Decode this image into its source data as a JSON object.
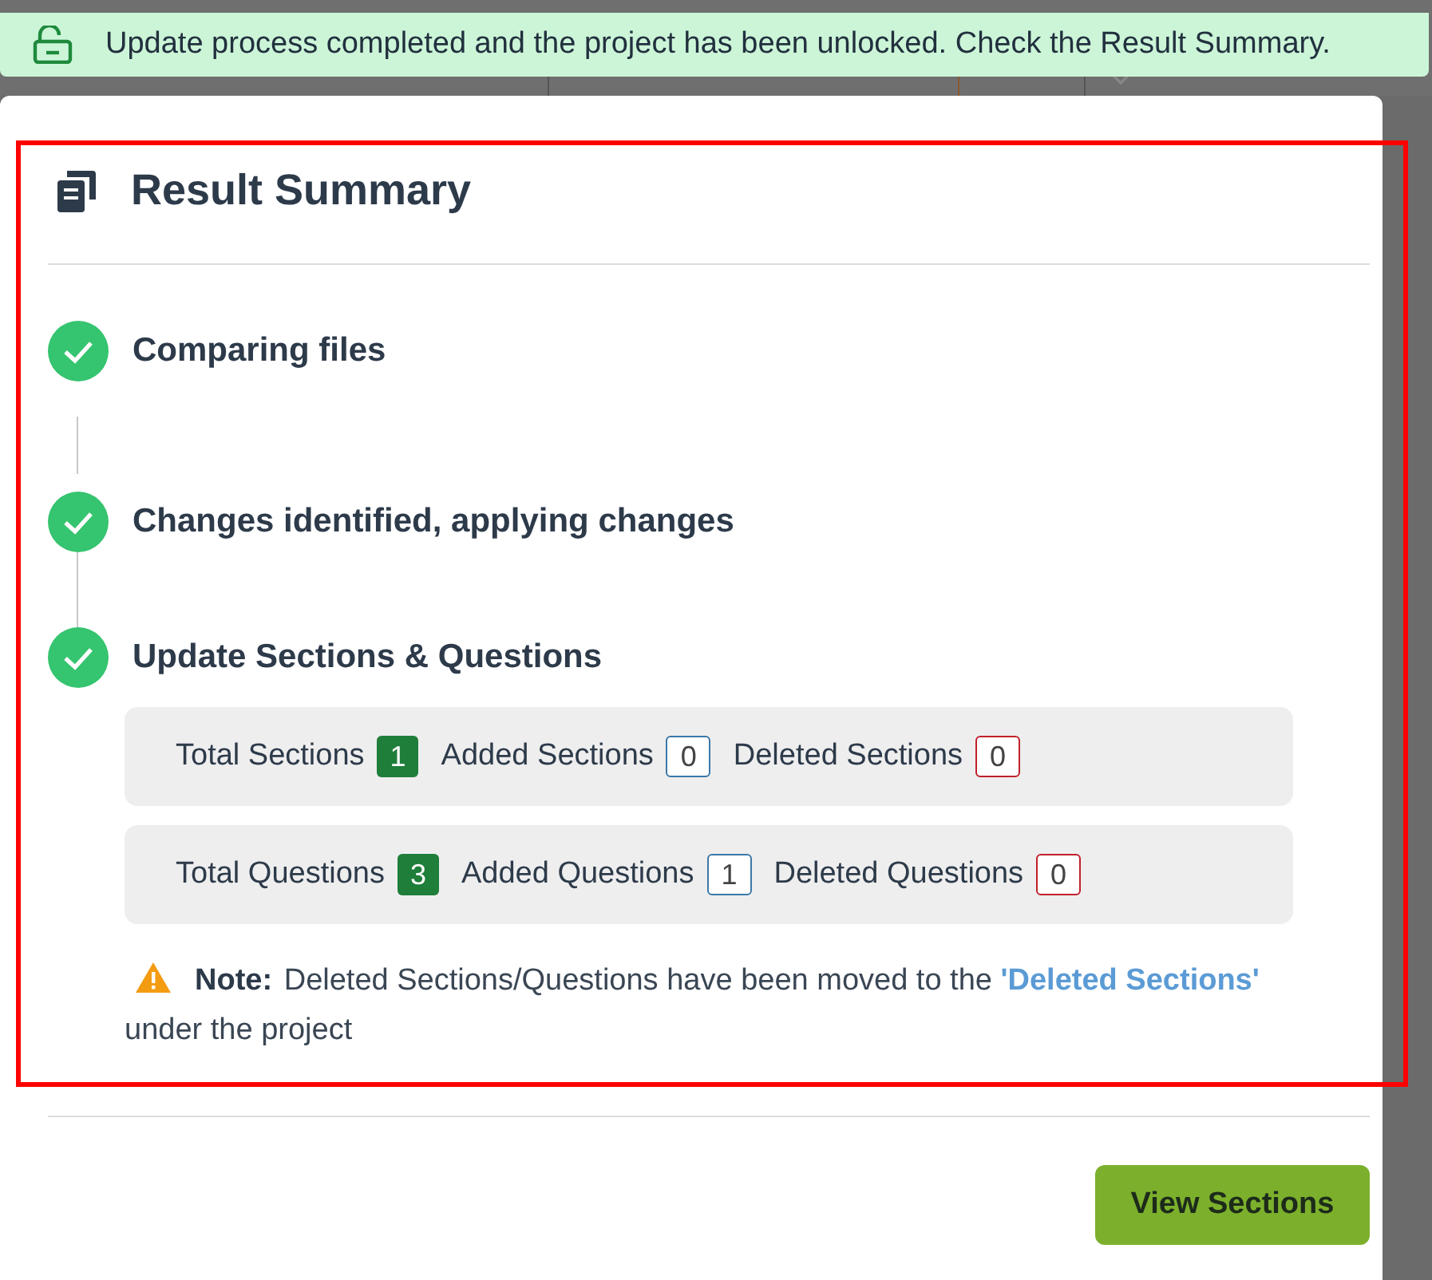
{
  "toast": {
    "message": "Update process completed and the project has been unlocked. Check the Result Summary."
  },
  "highlight": {
    "visible": true
  },
  "modal": {
    "title": "Result Summary",
    "steps": [
      {
        "label": "Comparing files",
        "done": true
      },
      {
        "label": "Changes identified, applying changes",
        "done": true
      },
      {
        "label": "Update Sections & Questions",
        "done": true
      }
    ],
    "stats": [
      [
        {
          "label": "Total Sections",
          "value": "1",
          "kind": "total"
        },
        {
          "label": "Added Sections",
          "value": "0",
          "kind": "added"
        },
        {
          "label": "Deleted Sections",
          "value": "0",
          "kind": "deleted"
        }
      ],
      [
        {
          "label": "Total Questions",
          "value": "3",
          "kind": "total"
        },
        {
          "label": "Added Questions",
          "value": "1",
          "kind": "added"
        },
        {
          "label": "Deleted Questions",
          "value": "0",
          "kind": "deleted"
        }
      ]
    ],
    "note": {
      "label": "Note:",
      "text": "Deleted Sections/Questions have been moved to the",
      "link": "'Deleted Sections'",
      "after": "under the project"
    },
    "button": "View Sections"
  }
}
